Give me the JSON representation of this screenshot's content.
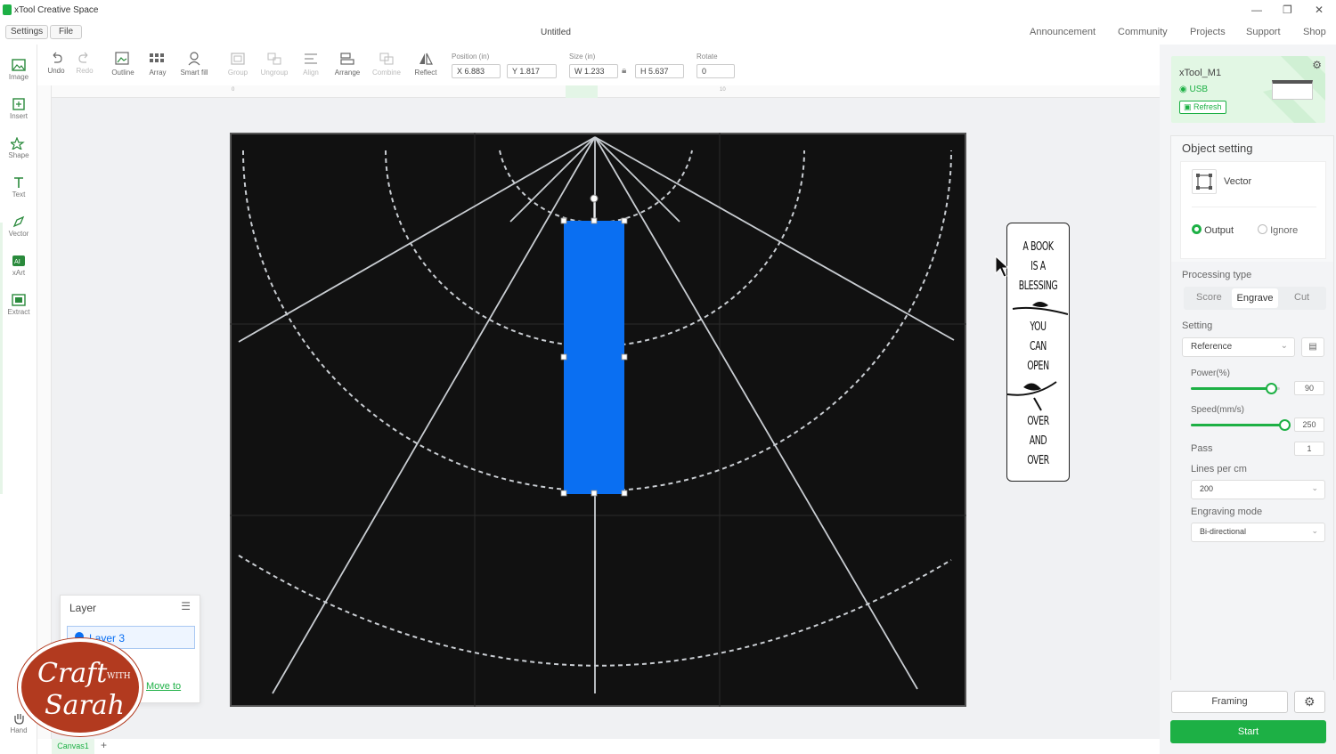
{
  "window": {
    "app_title": "xTool Creative Space",
    "doc_title": "Untitled"
  },
  "menu": {
    "settings": "Settings",
    "file": "File"
  },
  "nav": [
    "Announcement",
    "Community",
    "Projects",
    "Support",
    "Shop"
  ],
  "left_tools": [
    {
      "label": "Image",
      "icon": "image-icon"
    },
    {
      "label": "Insert",
      "icon": "insert-icon"
    },
    {
      "label": "Shape",
      "icon": "shape-icon"
    },
    {
      "label": "Text",
      "icon": "text-icon"
    },
    {
      "label": "Vector",
      "icon": "pen-icon"
    },
    {
      "label": "xArt",
      "icon": "xart-icon"
    },
    {
      "label": "Extract",
      "icon": "extract-icon"
    },
    {
      "label": "Hand",
      "icon": "hand-icon"
    }
  ],
  "toolbar": {
    "undo": "Undo",
    "redo": "Redo",
    "outline": "Outline",
    "array": "Array",
    "smart_fill": "Smart fill",
    "group": "Group",
    "ungroup": "Ungroup",
    "align": "Align",
    "arrange": "Arrange",
    "combine": "Combine",
    "reflect": "Reflect",
    "position_label": "Position (in)",
    "pos_x": "X 6.883",
    "pos_y": "Y 1.817",
    "size_label": "Size (in)",
    "size_w": "W 1.233",
    "size_h": "H 5.637",
    "rotate_label": "Rotate",
    "rotate": "0"
  },
  "ruler": {
    "t0": "0",
    "t10": "10"
  },
  "bookmark": {
    "lines": [
      "A BOOK",
      "IS A",
      "BLESSING",
      "YOU",
      "CAN",
      "OPEN",
      "OVER",
      "AND",
      "OVER"
    ]
  },
  "device": {
    "name": "xTool_M1",
    "connection": "USB",
    "refresh": "Refresh"
  },
  "object_setting": {
    "title": "Object setting",
    "type": "Vector",
    "output": "Output",
    "ignore": "Ignore",
    "processing_type_label": "Processing type",
    "processing_types": [
      "Score",
      "Engrave",
      "Cut"
    ],
    "setting_label": "Setting",
    "setting_value": "Reference",
    "power_label": "Power(%)",
    "power": "90",
    "speed_label": "Speed(mm/s)",
    "speed": "250",
    "pass_label": "Pass",
    "pass": "1",
    "lines_label": "Lines per cm",
    "lines_value": "200",
    "mode_label": "Engraving mode",
    "mode_value": "Bi-directional"
  },
  "slider_levels": {
    "power": 0.9,
    "speed": 1.0
  },
  "actions": {
    "framing": "Framing",
    "start": "Start"
  },
  "layer": {
    "title": "Layer",
    "item": "Layer 3",
    "move_to": "Move to"
  },
  "canvas_tab": "Canvas1",
  "logo": {
    "line1": "Craft",
    "line2": "WITH",
    "line3": "Sarah"
  },
  "colors": {
    "accent": "#1db045",
    "selection": "#0a6ff2"
  }
}
